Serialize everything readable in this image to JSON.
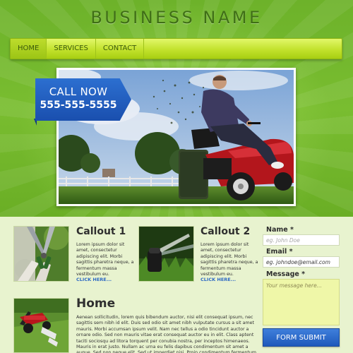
{
  "header": {
    "brand": "BUSINESS NAME"
  },
  "nav": {
    "items": [
      {
        "label": "HOME"
      },
      {
        "label": "SERVICES"
      },
      {
        "label": "CONTACT"
      }
    ]
  },
  "hero": {
    "call_now": "CALL NOW",
    "phone": "555-555-5555"
  },
  "callouts": [
    {
      "title": "Callout 1",
      "text": "Lorem ipsum dolor sit amet, consectetur adipiscing elit. Morbi sagittis pharetra neque, a fermentum massa vestibulum eu.",
      "link": "CLICK HERE..."
    },
    {
      "title": "Callout 2",
      "text": "Lorem ipsum dolor sit amet, consectetur adipiscing elit. Morbi sagittis pharetra neque, a fermentum massa vestibulum eu.",
      "link": "CLICK HERE..."
    }
  ],
  "form": {
    "name_label": "Name *",
    "name_placeholder": "eg. John Doe",
    "email_label": "Email *",
    "email_value": "eg. johndoe@email.com",
    "message_label": "Message *",
    "message_placeholder": "Your message here...",
    "submit_label": "FORM SUBMIT"
  },
  "home": {
    "title": "Home",
    "text": "Aenean sollicitudin, lorem quis bibendum auctor, nisi elit consequat ipsum, nec sagittis sem nibh id elit. Duis sed odio sit amet nibh vulputate cursus a sit amet mauris. Morbi accumsan ipsum velit. Nam nec tellus a odio tincidunt auctor a ornare odio. Sed non mauris vitae erat consequat auctor eu in elit. Class aptent taciti sociosqu ad litora torquent per conubia nostra, per inceptos himenaeos. Mauris in erat justo. Nullam ac urna eu felis dapibus condimentum sit amet a augue. Sed non neque elit. Sed ut imperdiet nisi. Proin condimentum fermentum nunc."
  },
  "colors": {
    "header_green": "#79bd30",
    "nav_lime": "#c2e22c",
    "ribbon_blue": "#2c6fd0",
    "link_blue": "#2f6ac4",
    "content_bg": "#e8f3cf",
    "textarea_bg": "#eff7a8"
  },
  "icons": {
    "hero": "lawn-mowing-photo",
    "callout_1": "hedge-shears-photo",
    "callout_2": "sprinkler-photo",
    "home": "lawn-mower-photo"
  }
}
